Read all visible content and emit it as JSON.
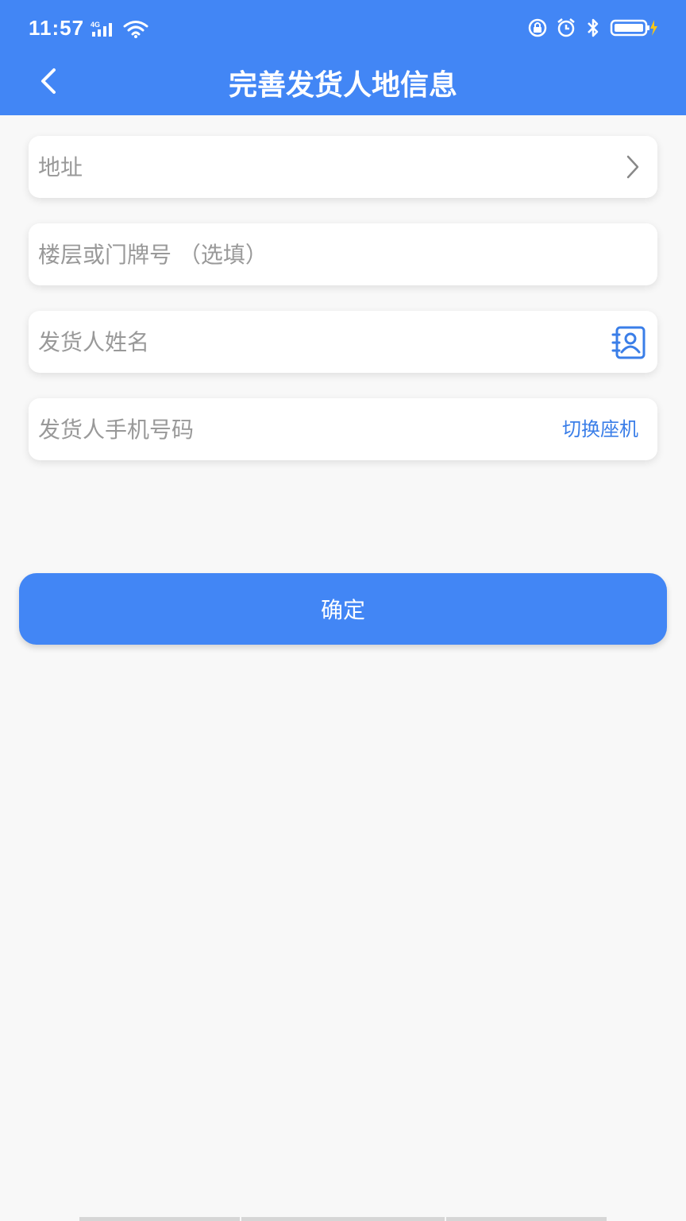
{
  "status_bar": {
    "time": "11:57",
    "network": "4G",
    "icons": [
      "signal-icon",
      "wifi-icon",
      "lock-rotation-icon",
      "alarm-icon",
      "bluetooth-icon",
      "battery-charging-icon"
    ]
  },
  "header": {
    "title": "完善发货人地信息",
    "back_icon": "back-arrow-icon",
    "background_color": "#4286f5"
  },
  "form": {
    "address_placeholder": "地址",
    "floor_placeholder": "楼层或门牌号 （选填）",
    "name_placeholder": "发货人姓名",
    "phone_placeholder": "发货人手机号码",
    "switch_label": "切换座机",
    "accent_color": "#3a7ee8"
  },
  "confirm_label": "确定"
}
